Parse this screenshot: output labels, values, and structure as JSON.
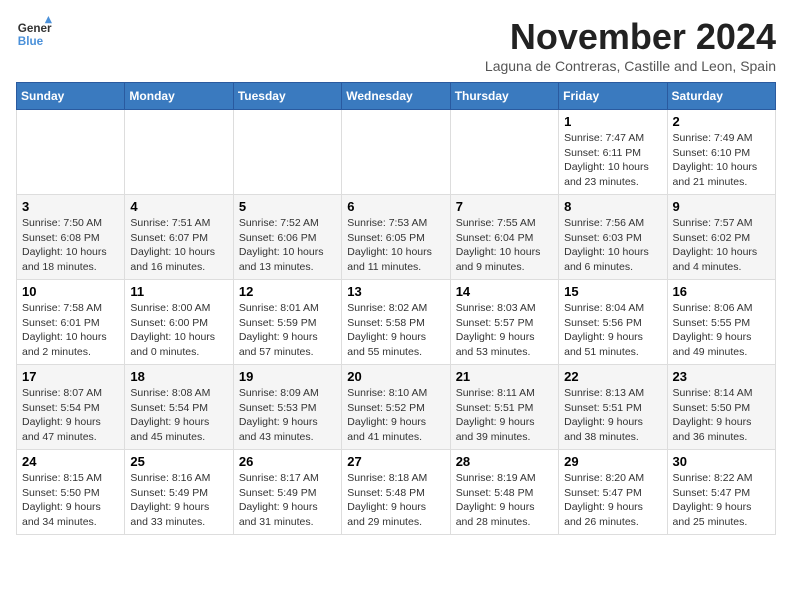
{
  "logo": {
    "line1": "General",
    "line2": "Blue"
  },
  "title": "November 2024",
  "location": "Laguna de Contreras, Castille and Leon, Spain",
  "weekdays": [
    "Sunday",
    "Monday",
    "Tuesday",
    "Wednesday",
    "Thursday",
    "Friday",
    "Saturday"
  ],
  "weeks": [
    [
      {
        "day": "",
        "content": ""
      },
      {
        "day": "",
        "content": ""
      },
      {
        "day": "",
        "content": ""
      },
      {
        "day": "",
        "content": ""
      },
      {
        "day": "",
        "content": ""
      },
      {
        "day": "1",
        "content": "Sunrise: 7:47 AM\nSunset: 6:11 PM\nDaylight: 10 hours and 23 minutes."
      },
      {
        "day": "2",
        "content": "Sunrise: 7:49 AM\nSunset: 6:10 PM\nDaylight: 10 hours and 21 minutes."
      }
    ],
    [
      {
        "day": "3",
        "content": "Sunrise: 7:50 AM\nSunset: 6:08 PM\nDaylight: 10 hours and 18 minutes."
      },
      {
        "day": "4",
        "content": "Sunrise: 7:51 AM\nSunset: 6:07 PM\nDaylight: 10 hours and 16 minutes."
      },
      {
        "day": "5",
        "content": "Sunrise: 7:52 AM\nSunset: 6:06 PM\nDaylight: 10 hours and 13 minutes."
      },
      {
        "day": "6",
        "content": "Sunrise: 7:53 AM\nSunset: 6:05 PM\nDaylight: 10 hours and 11 minutes."
      },
      {
        "day": "7",
        "content": "Sunrise: 7:55 AM\nSunset: 6:04 PM\nDaylight: 10 hours and 9 minutes."
      },
      {
        "day": "8",
        "content": "Sunrise: 7:56 AM\nSunset: 6:03 PM\nDaylight: 10 hours and 6 minutes."
      },
      {
        "day": "9",
        "content": "Sunrise: 7:57 AM\nSunset: 6:02 PM\nDaylight: 10 hours and 4 minutes."
      }
    ],
    [
      {
        "day": "10",
        "content": "Sunrise: 7:58 AM\nSunset: 6:01 PM\nDaylight: 10 hours and 2 minutes."
      },
      {
        "day": "11",
        "content": "Sunrise: 8:00 AM\nSunset: 6:00 PM\nDaylight: 10 hours and 0 minutes."
      },
      {
        "day": "12",
        "content": "Sunrise: 8:01 AM\nSunset: 5:59 PM\nDaylight: 9 hours and 57 minutes."
      },
      {
        "day": "13",
        "content": "Sunrise: 8:02 AM\nSunset: 5:58 PM\nDaylight: 9 hours and 55 minutes."
      },
      {
        "day": "14",
        "content": "Sunrise: 8:03 AM\nSunset: 5:57 PM\nDaylight: 9 hours and 53 minutes."
      },
      {
        "day": "15",
        "content": "Sunrise: 8:04 AM\nSunset: 5:56 PM\nDaylight: 9 hours and 51 minutes."
      },
      {
        "day": "16",
        "content": "Sunrise: 8:06 AM\nSunset: 5:55 PM\nDaylight: 9 hours and 49 minutes."
      }
    ],
    [
      {
        "day": "17",
        "content": "Sunrise: 8:07 AM\nSunset: 5:54 PM\nDaylight: 9 hours and 47 minutes."
      },
      {
        "day": "18",
        "content": "Sunrise: 8:08 AM\nSunset: 5:54 PM\nDaylight: 9 hours and 45 minutes."
      },
      {
        "day": "19",
        "content": "Sunrise: 8:09 AM\nSunset: 5:53 PM\nDaylight: 9 hours and 43 minutes."
      },
      {
        "day": "20",
        "content": "Sunrise: 8:10 AM\nSunset: 5:52 PM\nDaylight: 9 hours and 41 minutes."
      },
      {
        "day": "21",
        "content": "Sunrise: 8:11 AM\nSunset: 5:51 PM\nDaylight: 9 hours and 39 minutes."
      },
      {
        "day": "22",
        "content": "Sunrise: 8:13 AM\nSunset: 5:51 PM\nDaylight: 9 hours and 38 minutes."
      },
      {
        "day": "23",
        "content": "Sunrise: 8:14 AM\nSunset: 5:50 PM\nDaylight: 9 hours and 36 minutes."
      }
    ],
    [
      {
        "day": "24",
        "content": "Sunrise: 8:15 AM\nSunset: 5:50 PM\nDaylight: 9 hours and 34 minutes."
      },
      {
        "day": "25",
        "content": "Sunrise: 8:16 AM\nSunset: 5:49 PM\nDaylight: 9 hours and 33 minutes."
      },
      {
        "day": "26",
        "content": "Sunrise: 8:17 AM\nSunset: 5:49 PM\nDaylight: 9 hours and 31 minutes."
      },
      {
        "day": "27",
        "content": "Sunrise: 8:18 AM\nSunset: 5:48 PM\nDaylight: 9 hours and 29 minutes."
      },
      {
        "day": "28",
        "content": "Sunrise: 8:19 AM\nSunset: 5:48 PM\nDaylight: 9 hours and 28 minutes."
      },
      {
        "day": "29",
        "content": "Sunrise: 8:20 AM\nSunset: 5:47 PM\nDaylight: 9 hours and 26 minutes."
      },
      {
        "day": "30",
        "content": "Sunrise: 8:22 AM\nSunset: 5:47 PM\nDaylight: 9 hours and 25 minutes."
      }
    ]
  ]
}
